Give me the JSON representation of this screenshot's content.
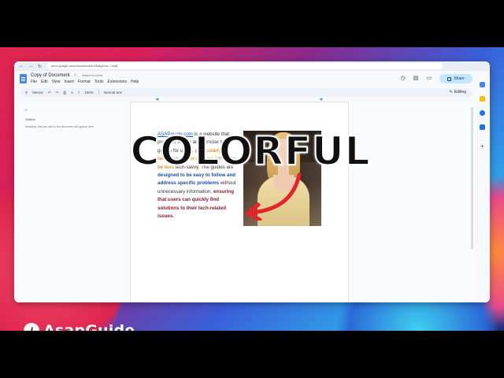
{
  "browser": {
    "url": "docs.google.com/document/d/1fNAgHcw...r/edit",
    "nav_back": "←",
    "nav_forward": "→",
    "nav_reload": "↻"
  },
  "doc": {
    "title": "Copy of Document",
    "saved_status": "Saved to Drive",
    "menu": [
      "File",
      "Edit",
      "View",
      "Insert",
      "Format",
      "Tools",
      "Extensions",
      "Help"
    ],
    "share_label": "Share",
    "toolbar": {
      "search_label": "Menus",
      "zoom": "100%",
      "style": "Normal text",
      "mode": "Editing"
    },
    "outline": {
      "title": "Outline",
      "hint": "Headings that you add to the document will appear here."
    },
    "body": {
      "link": "ASAPguide.com",
      "t1": " is a website that provides simple and concise tech guides for users, ",
      "orange": "particularly targeting senior citizens who may be less",
      "t2": " tech-savvy. The guides are ",
      "blue": "designed to be easy to follow and address specific problems",
      "t3": " without unnecessary information, ",
      "maroon": "ensuring that users can quickly find solutions to their tech-related issues."
    }
  },
  "overlay": {
    "title": "COLORFUL",
    "brand": "AsapGuide",
    "brand_mark": "/"
  },
  "colors": {
    "accent": "#e3242b",
    "link": "#1a57c7",
    "orange": "#e8952a",
    "blue": "#1e4fa0",
    "maroon": "#8a1c2c",
    "share_bg": "#c2e7ff"
  },
  "icons": [
    "star-icon",
    "history-icon",
    "comment-icon",
    "video-icon",
    "lock-icon",
    "back-arrow-icon",
    "pencil-icon",
    "arrow-annotation-icon"
  ]
}
